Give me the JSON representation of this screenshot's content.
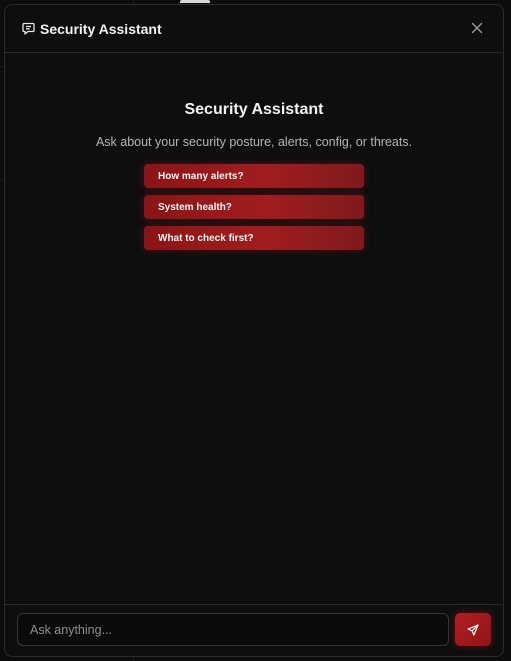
{
  "modal": {
    "title": "Security Assistant",
    "close_label": "×"
  },
  "welcome": {
    "title": "Security Assistant",
    "subtitle": "Ask about your security posture, alerts, config, or threats."
  },
  "suggestions": [
    {
      "label": "How many alerts?"
    },
    {
      "label": "System health?"
    },
    {
      "label": "What to check first?"
    }
  ],
  "composer": {
    "placeholder": "Ask anything...",
    "value": ""
  },
  "icons": {
    "header": "chat-bubble-icon",
    "close": "close-icon",
    "send": "send-icon"
  },
  "colors": {
    "accent": "#a11d1f",
    "background": "#0e0e0f",
    "border": "#2a2a2d"
  }
}
